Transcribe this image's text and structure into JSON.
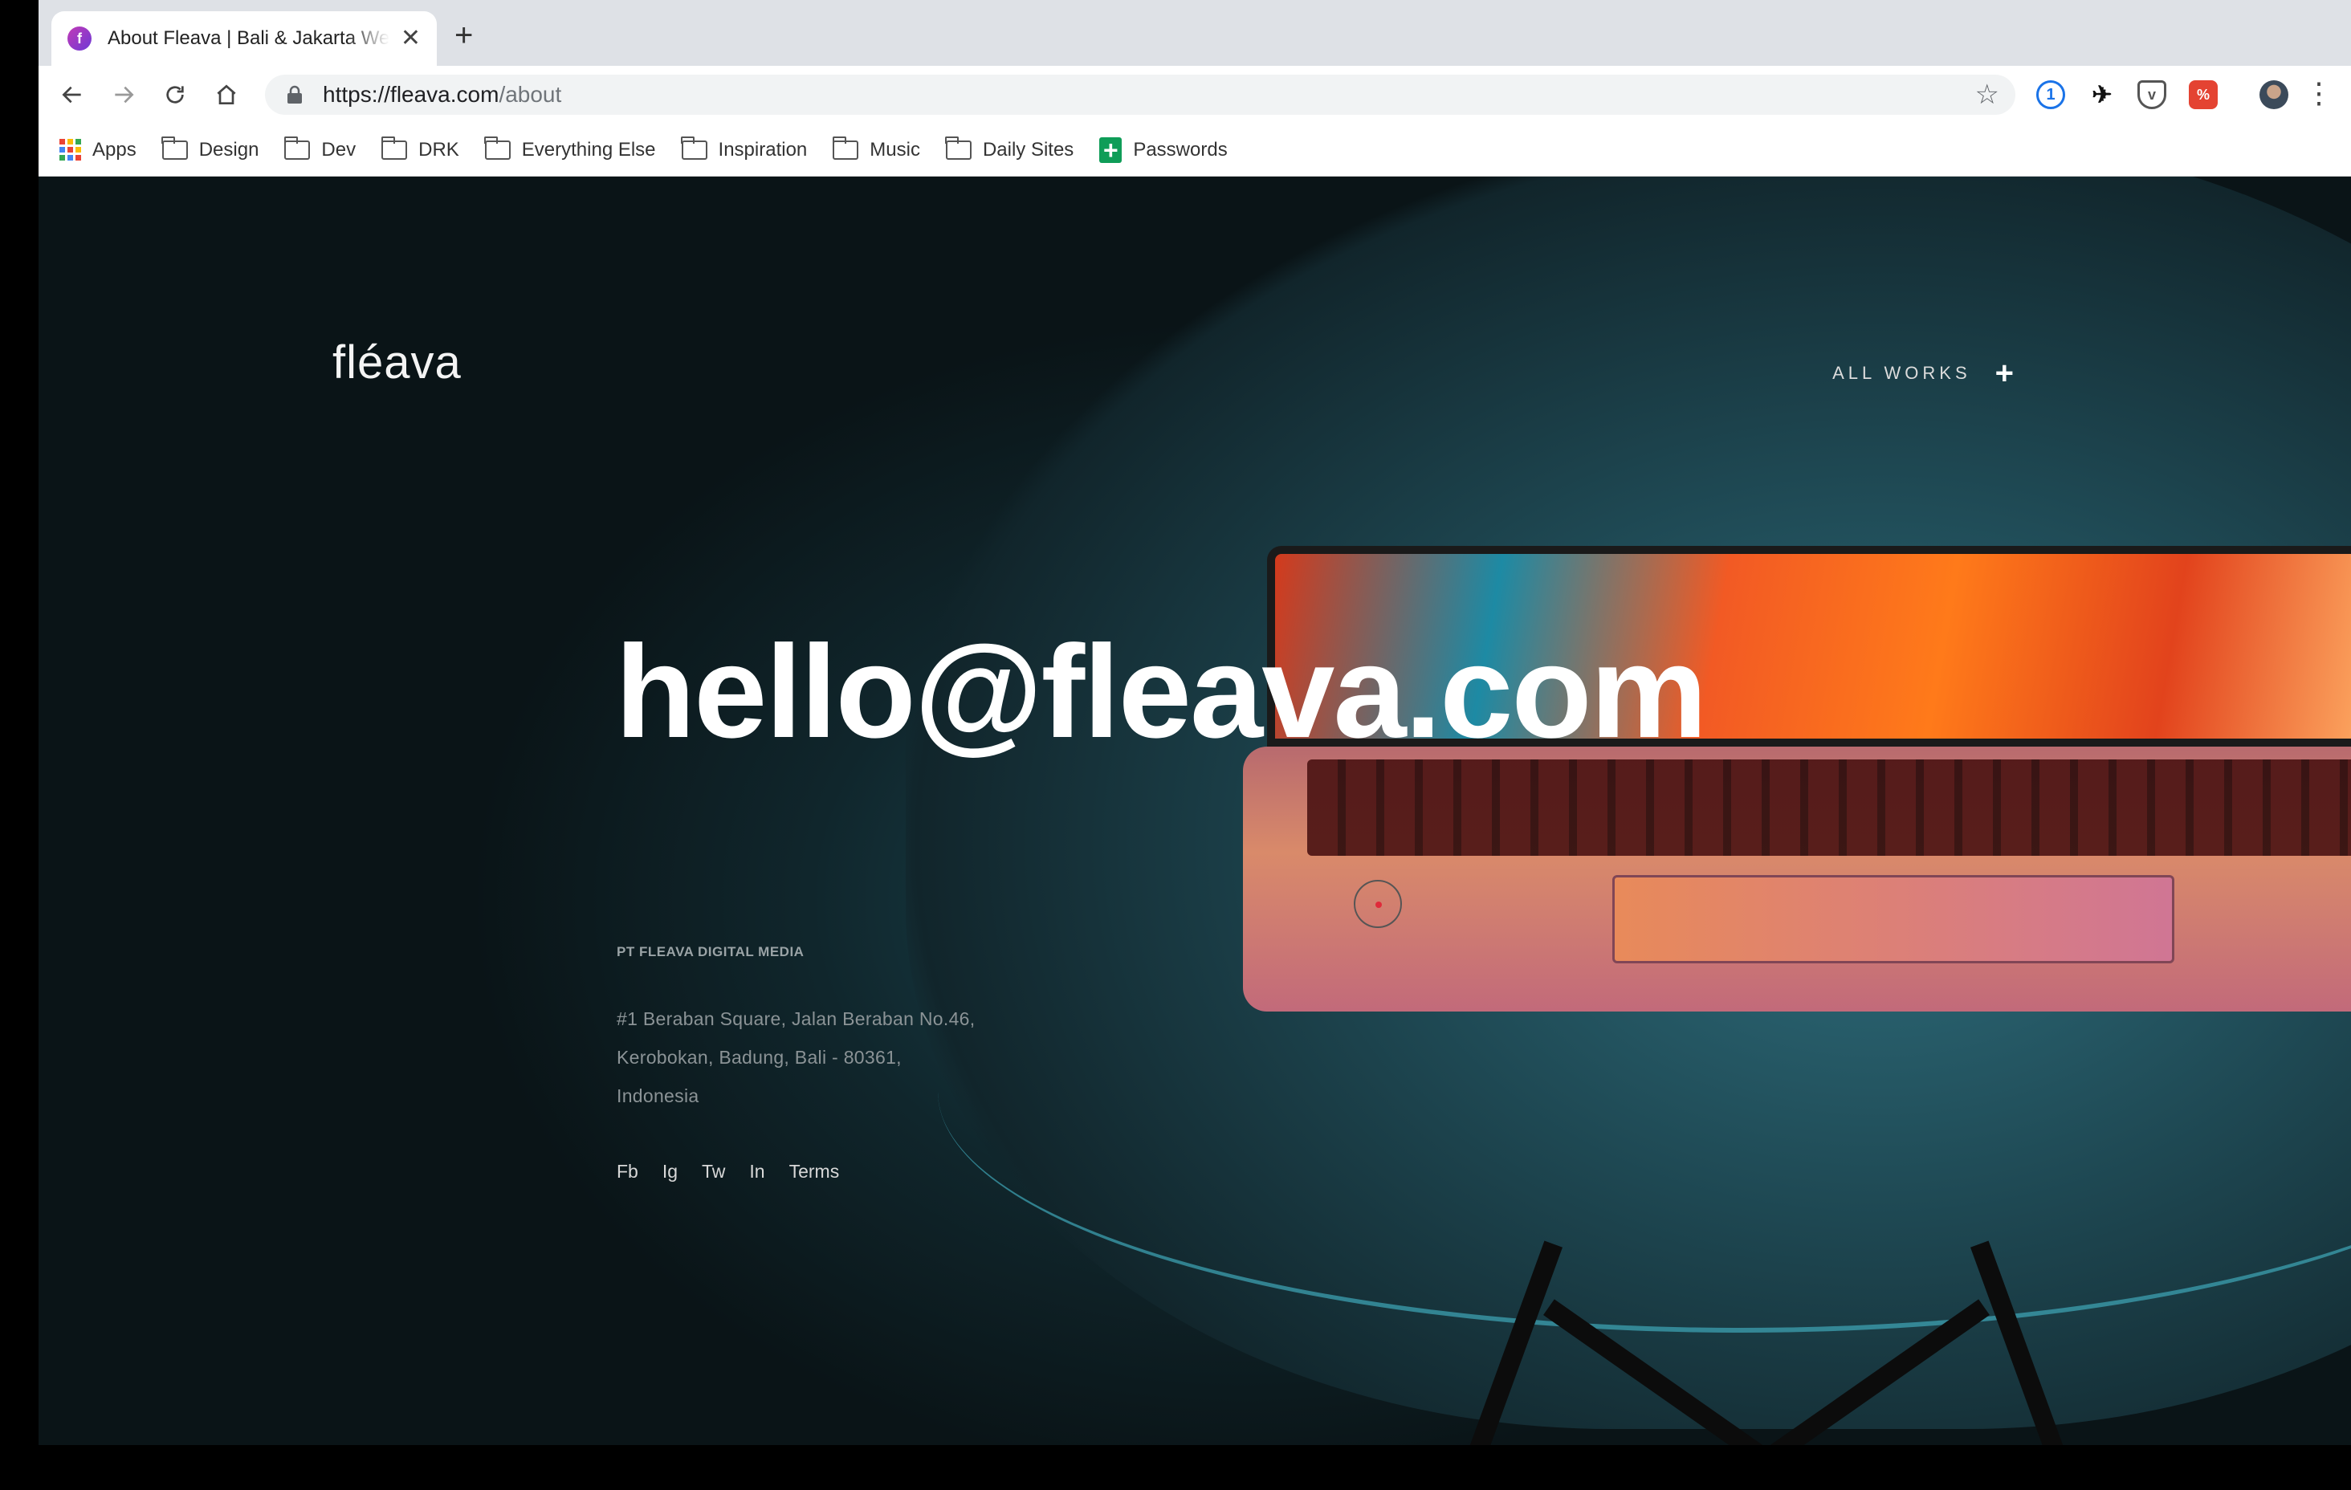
{
  "browser": {
    "tab_title": "About Fleava | Bali & Jakarta Web Design Agency",
    "tab_favicon_letter": "f",
    "new_tab_icon": "plus-icon",
    "url_host": "https://fleava.com",
    "url_path": "/about",
    "extensions": [
      "onepassword-icon",
      "bird-icon",
      "pocket-icon",
      "todoist-icon",
      "profile-avatar"
    ]
  },
  "bookmarks": [
    {
      "label": "Apps",
      "icon": "apps-grid-icon"
    },
    {
      "label": "Design",
      "icon": "folder-icon"
    },
    {
      "label": "Dev",
      "icon": "folder-icon"
    },
    {
      "label": "DRK",
      "icon": "folder-icon"
    },
    {
      "label": "Everything Else",
      "icon": "folder-icon"
    },
    {
      "label": "Inspiration",
      "icon": "folder-icon"
    },
    {
      "label": "Music",
      "icon": "folder-icon"
    },
    {
      "label": "Daily Sites",
      "icon": "folder-icon"
    },
    {
      "label": "Passwords",
      "icon": "sheets-icon"
    }
  ],
  "site": {
    "logo": "fléava",
    "nav_all_works": "ALL WORKS",
    "nav_plus": "+",
    "email": "hello@fleava.com",
    "company": "PT FLEAVA DIGITAL MEDIA",
    "address": [
      "#1 Beraban Square, Jalan Beraban No.46,",
      "Kerobokan, Badung, Bali - 80361,",
      "Indonesia"
    ],
    "social": [
      "Fb",
      "Ig",
      "Tw",
      "In",
      "Terms"
    ]
  },
  "colors": {
    "chrome_bg": "#dee1e6",
    "page_bg": "#0b1418",
    "accent_cursor": "#e02a3a"
  }
}
